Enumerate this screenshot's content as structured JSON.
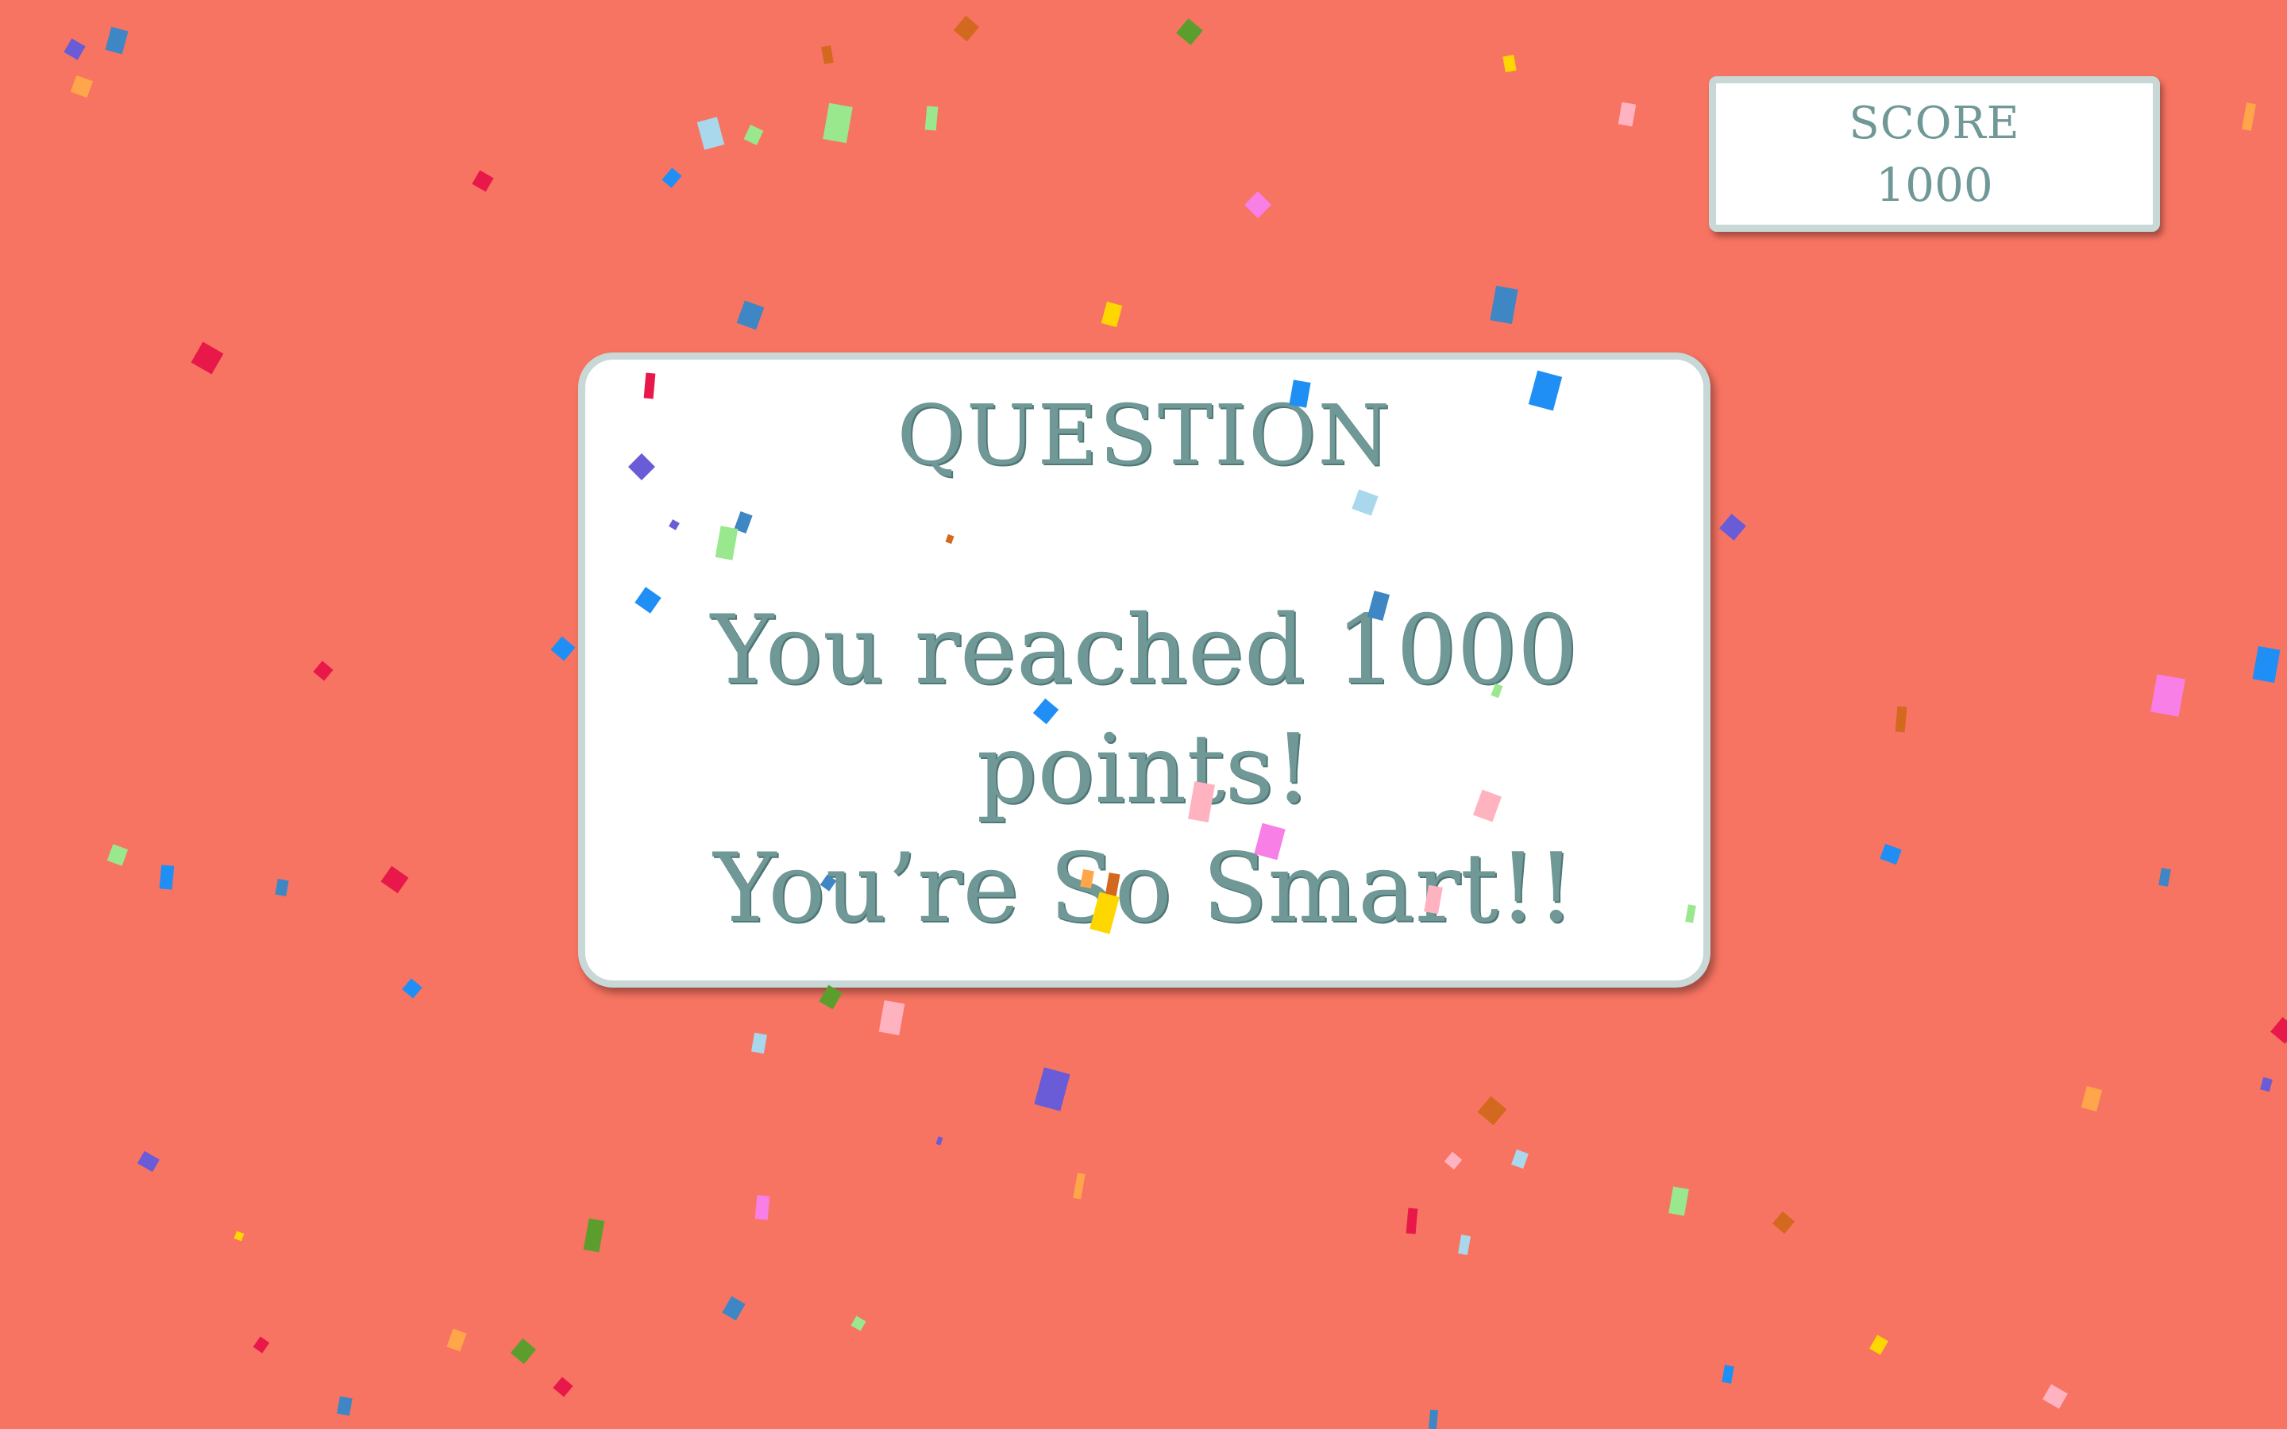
{
  "background_color": "#f87462",
  "card_text_color": "#6f9896",
  "card_border_color": "#c7d8d6",
  "score": {
    "label": "SCORE",
    "value": "1000"
  },
  "question": {
    "title": "QUESTION",
    "line1": "You reached 1000 points!",
    "line2": "You’re So Smart!!"
  },
  "confetti_colors": [
    "#e8194a",
    "#6a5bd6",
    "#3f86c4",
    "#1f8ef5",
    "#9ae88e",
    "#a9d8ec",
    "#ffd700",
    "#f77fe6",
    "#ffb3c0",
    "#ffa54a",
    "#d2691e",
    "#5c9e2e"
  ]
}
